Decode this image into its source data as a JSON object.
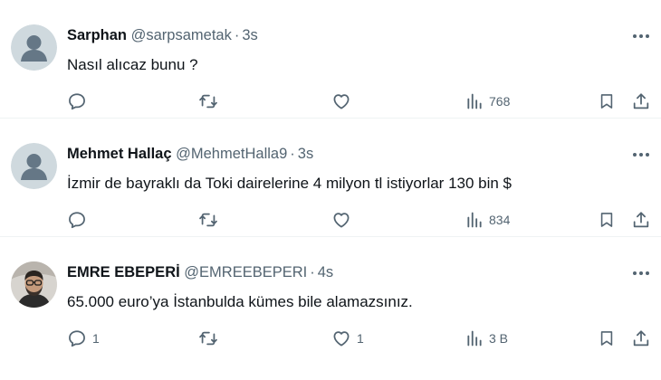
{
  "tweets": [
    {
      "name": "Sarphan",
      "handle": "@sarpsametak",
      "time": "3s",
      "text": "Nasıl alıcaz bunu ?",
      "reply_count": "",
      "like_count": "",
      "views": "768",
      "avatar_type": "default-profile"
    },
    {
      "name": "Mehmet Hallaç",
      "handle": "@MehmetHalla9",
      "time": "3s",
      "text": "İzmir de bayraklı da Toki dairelerine 4 milyon tl istiyorlar 130 bin $",
      "reply_count": "",
      "like_count": "",
      "views": "834",
      "avatar_type": "default-profile"
    },
    {
      "name": "EMRE EBEPERİ",
      "handle": "@EMREEBEPERI",
      "time": "4s",
      "text": "65.000 euro’ya İstanbulda kümes bile alamazsınız.",
      "reply_count": "1",
      "like_count": "1",
      "views": "3 B",
      "avatar_type": "photo"
    }
  ],
  "separator": "·",
  "icons": {
    "reply": "reply-icon",
    "retweet": "retweet-icon",
    "like": "heart-icon",
    "views": "views-icon",
    "bookmark": "bookmark-icon",
    "share": "share-icon",
    "more": "more-icon"
  },
  "colors": {
    "text": "#0f1419",
    "secondary": "#536471",
    "divider": "#eff3f4",
    "default_avatar_bg": "#cfd9de"
  }
}
